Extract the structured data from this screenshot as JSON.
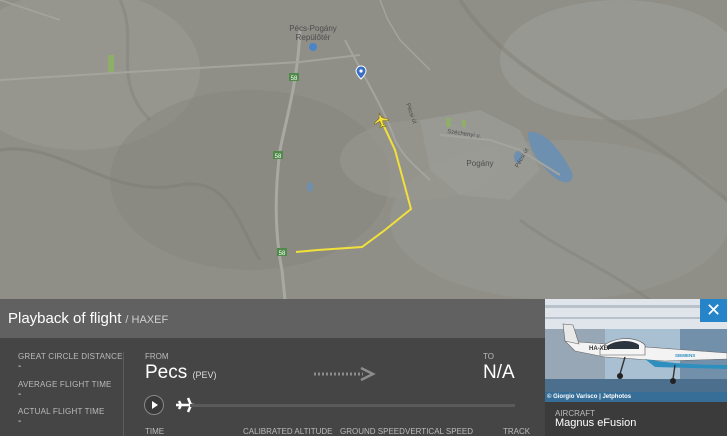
{
  "map": {
    "airport_name_line1": "Pécs-Pogány",
    "airport_name_line2": "Repülőtér",
    "town": "Pogány",
    "road_58": "58",
    "road_peczi": "Pécsi út",
    "road_szechenyi": "Széchenyi u.",
    "road_pecsi2": "Pécsi út"
  },
  "playback": {
    "title": "Playback of flight",
    "registration": "/ HAXEF",
    "stats": [
      {
        "label": "GREAT CIRCLE DISTANCE",
        "value": "-"
      },
      {
        "label": "AVERAGE FLIGHT TIME",
        "value": "-"
      },
      {
        "label": "ACTUAL FLIGHT TIME",
        "value": "-"
      }
    ],
    "from_label": "FROM",
    "from_city": "Pecs",
    "from_code": "(PEV)",
    "to_label": "TO",
    "to_value": "N/A",
    "columns": [
      "TIME",
      "CALIBRATED ALTITUDE",
      "GROUND SPEED",
      "VERTICAL SPEED",
      "TRACK"
    ],
    "progress": 0.0
  },
  "aircraft_card": {
    "close_symbol": "✕",
    "photo_credit": "© Giorgio Varisco | Jetphotos",
    "photo_reg": "HA-XEF",
    "photo_brand": "SIEMENS",
    "label": "AIRCRAFT",
    "name": "Magnus eFusion"
  },
  "colors": {
    "track": "#f2e03a",
    "accent": "#2684c9"
  },
  "icons": [
    "play-icon",
    "plane-icon",
    "close-icon",
    "airport-marker-icon",
    "location-pin-icon",
    "arrow-right-icon"
  ]
}
